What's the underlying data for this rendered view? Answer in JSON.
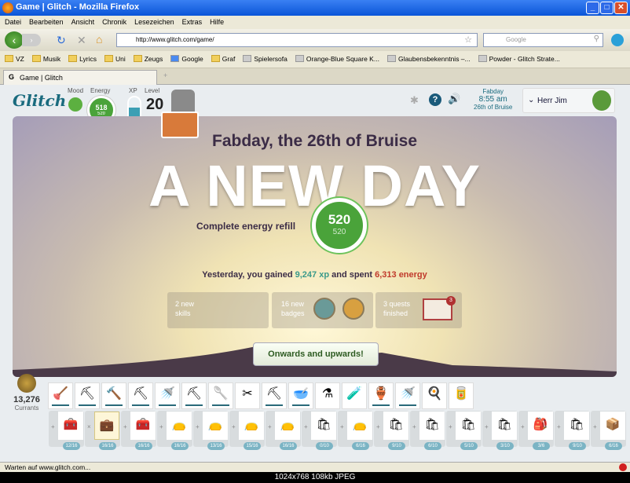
{
  "window": {
    "title": "Game | Glitch - Mozilla Firefox"
  },
  "menu": [
    "Datei",
    "Bearbeiten",
    "Ansicht",
    "Chronik",
    "Lesezeichen",
    "Extras",
    "Hilfe"
  ],
  "nav": {
    "url": "http://www.glitch.com/game/",
    "search_placeholder": "Google"
  },
  "bookmarks": [
    {
      "label": "VZ",
      "icon": "folder"
    },
    {
      "label": "Musik",
      "icon": "folder"
    },
    {
      "label": "Lyrics",
      "icon": "folder"
    },
    {
      "label": "Uni",
      "icon": "folder"
    },
    {
      "label": "Zeugs",
      "icon": "folder"
    },
    {
      "label": "Google",
      "icon": "google"
    },
    {
      "label": "Graf",
      "icon": "folder"
    },
    {
      "label": "Spielersofa",
      "icon": "page"
    },
    {
      "label": "Orange-Blue Square K...",
      "icon": "page"
    },
    {
      "label": "Glaubensbekenntnis –...",
      "icon": "wikipedia"
    },
    {
      "label": "Powder - Glitch Strate...",
      "icon": "page"
    }
  ],
  "tab": {
    "label": "Game | Glitch"
  },
  "game": {
    "logo": "Glitch",
    "labels": {
      "mood": "Mood",
      "energy": "Energy",
      "xp": "XP",
      "level": "Level"
    },
    "energy": {
      "current": "518",
      "max": "520"
    },
    "xp_fill_percent": 60,
    "level": "20",
    "clock": {
      "day": "Fabday",
      "time": "8:55 am",
      "date": "26th of Bruise"
    },
    "player": "Herr Jim",
    "newday": {
      "date": "Fabday, the 26th of Bruise",
      "title": "A NEW DAY",
      "refill": "Complete energy refill",
      "energy_current": "520",
      "energy_max": "520",
      "yesterday_prefix": "Yesterday, you gained ",
      "xp": "9,247 xp",
      "mid": " and spent ",
      "energy": "6,313 energy",
      "stats": [
        {
          "line1": "2 new",
          "line2": "skills"
        },
        {
          "line1": "16 new",
          "line2": "badges"
        },
        {
          "line1": "3 quests",
          "line2": "finished",
          "badge": "3"
        }
      ],
      "button": "Onwards and upwards!"
    },
    "currants": {
      "amount": "13,276",
      "label": "Currants"
    },
    "tools": [
      "🪠",
      "⛏",
      "🔨",
      "⛏",
      "🚿",
      "⛏",
      "🥄",
      "✂",
      "⛏",
      "🥣",
      "⚗",
      "🧪",
      "🏺",
      "🚿",
      "🍳",
      "🥫"
    ],
    "bags": [
      {
        "c": "12/16",
        "i": "🧰"
      },
      {
        "c": "16/16",
        "i": "💼",
        "sel": true
      },
      {
        "c": "16/16",
        "i": "🧰"
      },
      {
        "c": "16/16",
        "i": "👝"
      },
      {
        "c": "13/16",
        "i": "👝"
      },
      {
        "c": "15/16",
        "i": "👝"
      },
      {
        "c": "16/16",
        "i": "👝"
      },
      {
        "c": "0/10",
        "i": "🛍"
      },
      {
        "c": "6/16",
        "i": "👝"
      },
      {
        "c": "9/10",
        "i": "🛍"
      },
      {
        "c": "6/10",
        "i": "🛍"
      },
      {
        "c": "5/10",
        "i": "🛍"
      },
      {
        "c": "3/10",
        "i": "🛍"
      },
      {
        "c": "3/6",
        "i": "🎒"
      },
      {
        "c": "9/10",
        "i": "🛍"
      },
      {
        "c": "6/16",
        "i": "📦"
      }
    ]
  },
  "status": "Warten auf www.glitch.com...",
  "footer": "1024x768 108kb JPEG",
  "colors": {
    "xp": "#3a9a8a",
    "energy_spent": "#c0392b",
    "energy_green": "#4aa33a",
    "logo": "#1a6b7e"
  }
}
